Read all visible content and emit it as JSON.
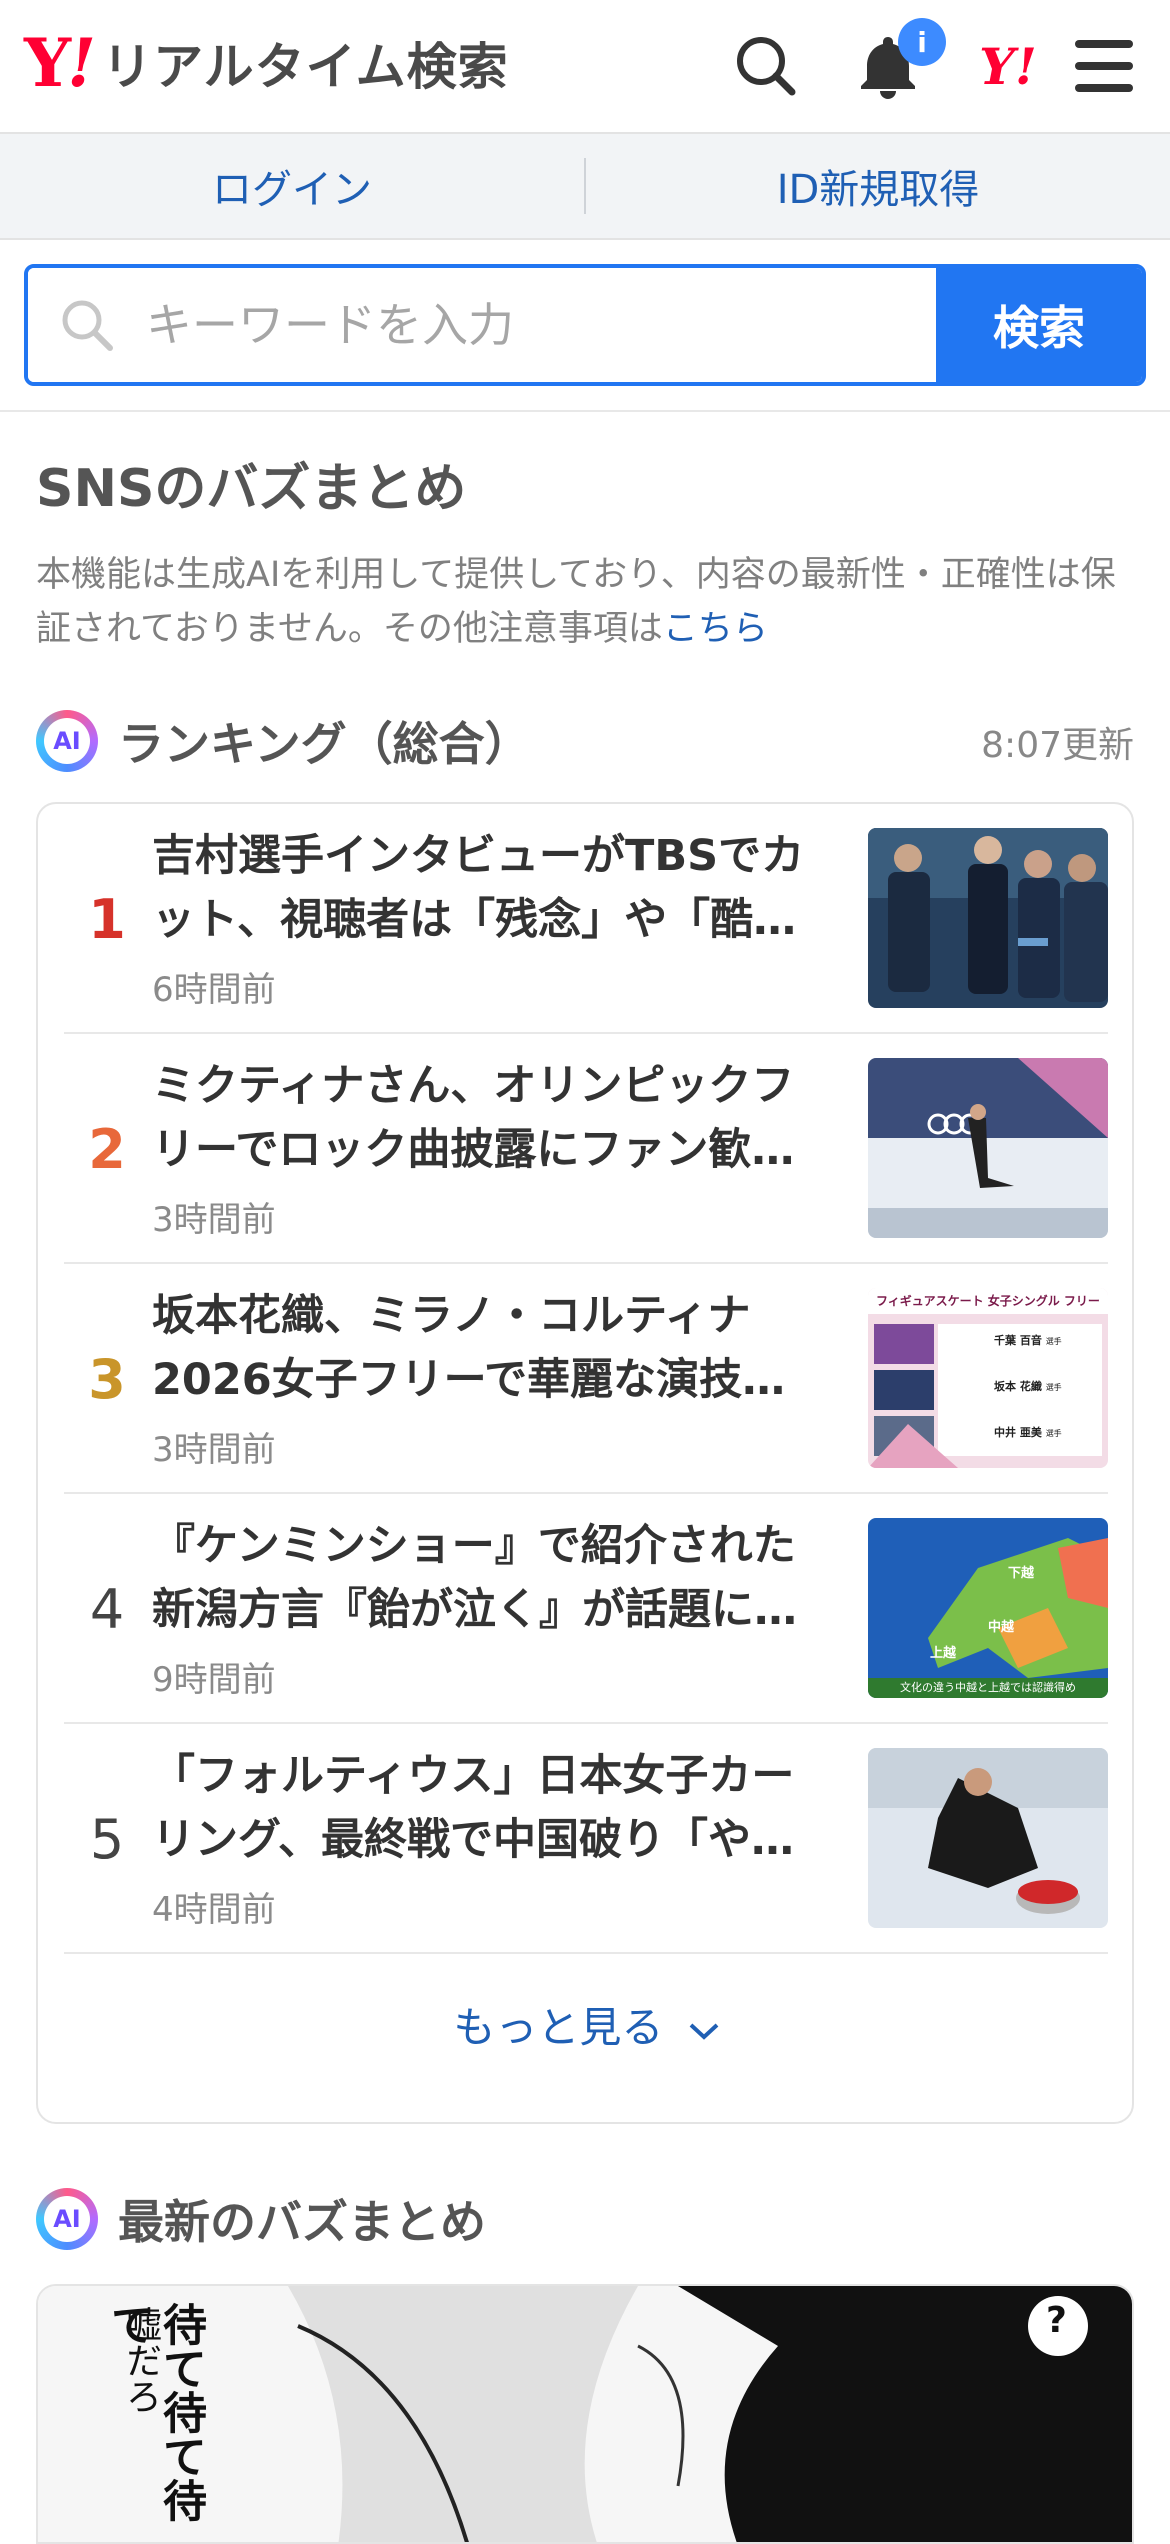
{
  "header": {
    "logo_y": "Y",
    "logo_bang": "!",
    "logo_text": "リアルタイム検索",
    "notification_badge": "i",
    "yj_logo": "Y!",
    "icons": [
      "search-icon",
      "bell-icon",
      "yahoo-japan-logo",
      "menu-icon"
    ]
  },
  "login_bar": {
    "login": "ログイン",
    "register": "ID新規取得"
  },
  "search": {
    "placeholder": "キーワードを入力",
    "button": "検索"
  },
  "buzz": {
    "title": "SNSのバズまとめ",
    "disclaimer": "本機能は生成AIを利用して提供しており、内容の最新性・正確性は保証されておりません。その他注意事項は",
    "disclaimer_link": "こちら"
  },
  "ranking": {
    "ai_badge": "AI",
    "title": "ランキング（総合）",
    "updated": "8:07更新",
    "items": [
      {
        "rank": "1",
        "title": "吉村選手インタビューがTBSでカット、視聴者は「残念」や「酷…",
        "time": "6時間前",
        "rank_color": "#d6322a"
      },
      {
        "rank": "2",
        "title": "ミクティナさん、オリンピックフリーでロック曲披露にファン歓…",
        "time": "3時間前",
        "rank_color": "#e8683a"
      },
      {
        "rank": "3",
        "title": "坂本花織、ミラノ・コルティナ2026女子フリーで華麗な演技…",
        "time": "3時間前",
        "rank_color": "#c9952a"
      },
      {
        "rank": "4",
        "title": "『ケンミンショー』で紹介された新潟方言『飴が泣く』が話題に…",
        "time": "9時間前",
        "rank_color": "#444444"
      },
      {
        "rank": "5",
        "title": "「フォルティウス」日本女子カーリング、最終戦で中国破り「や…",
        "time": "4時間前",
        "rank_color": "#444444"
      }
    ],
    "more": "もっと見る"
  },
  "thumb_text": {
    "skate_title": "フィギュアスケート 女子シングル フリー",
    "skaters": [
      {
        "name": "千葉 百音",
        "suffix": "選手"
      },
      {
        "name": "坂本 花織",
        "suffix": "選手"
      },
      {
        "name": "中井 亜美",
        "suffix": "選手"
      }
    ],
    "map_cities": [
      "下越",
      "中越",
      "上越"
    ],
    "map_caption": "文化の違う中越と上越では認識得め"
  },
  "latest": {
    "ai_badge": "AI",
    "title": "最新のバズまとめ",
    "manga_text": "待て待て待て",
    "manga_text2": "嘘だろ",
    "manga_mark": "?"
  }
}
